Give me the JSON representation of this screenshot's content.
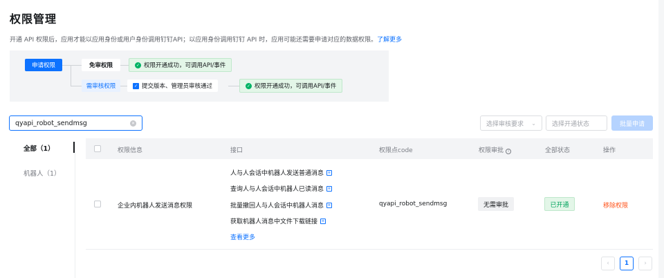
{
  "header": {
    "title": "权限管理",
    "description": "开通 API 权限后，应用才能以应用身份或用户身份调用钉钉API；以应用身份调用钉钉 API 时，应用可能还需要申请对应的数据权限。",
    "learn_more": "了解更多"
  },
  "flow": {
    "apply": "申请权限",
    "free_review": "免审权限",
    "success_1": "权限开通成功，可调用API/事件",
    "needs_review": "需审核权限",
    "submit": "提交版本、管理员审核通过",
    "success_2": "权限开通成功，可调用API/事件"
  },
  "filters": {
    "search_value": "qyapi_robot_sendmsg",
    "review_select": "选择审核要求",
    "status_select": "选择开通状态",
    "batch_apply": "批量申请"
  },
  "sidebar": {
    "items": [
      {
        "label": "全部（1）"
      },
      {
        "label": "机器人（1）"
      }
    ]
  },
  "table": {
    "columns": {
      "info": "权限信息",
      "api": "接口",
      "code": "权限点code",
      "review": "权限审批",
      "status": "全部状态",
      "action": "操作"
    },
    "row": {
      "name": "企业内机器人发送消息权限",
      "apis": [
        "人与人会话中机器人发送普通消息",
        "查询人与人会话中机器人已读消息",
        "批量撤回人与人会话中机器人消息",
        "获取机器人消息中文件下载链接"
      ],
      "view_more": "查看更多",
      "code": "qyapi_robot_sendmsg",
      "review": "无需审批",
      "status": "已开通",
      "action": "移除权限"
    }
  },
  "pagination": {
    "current": "1",
    "prev": "‹",
    "next": "›"
  },
  "colors": {
    "accent": "#0d72ff",
    "success": "#00b365",
    "danger": "#ff5219"
  }
}
